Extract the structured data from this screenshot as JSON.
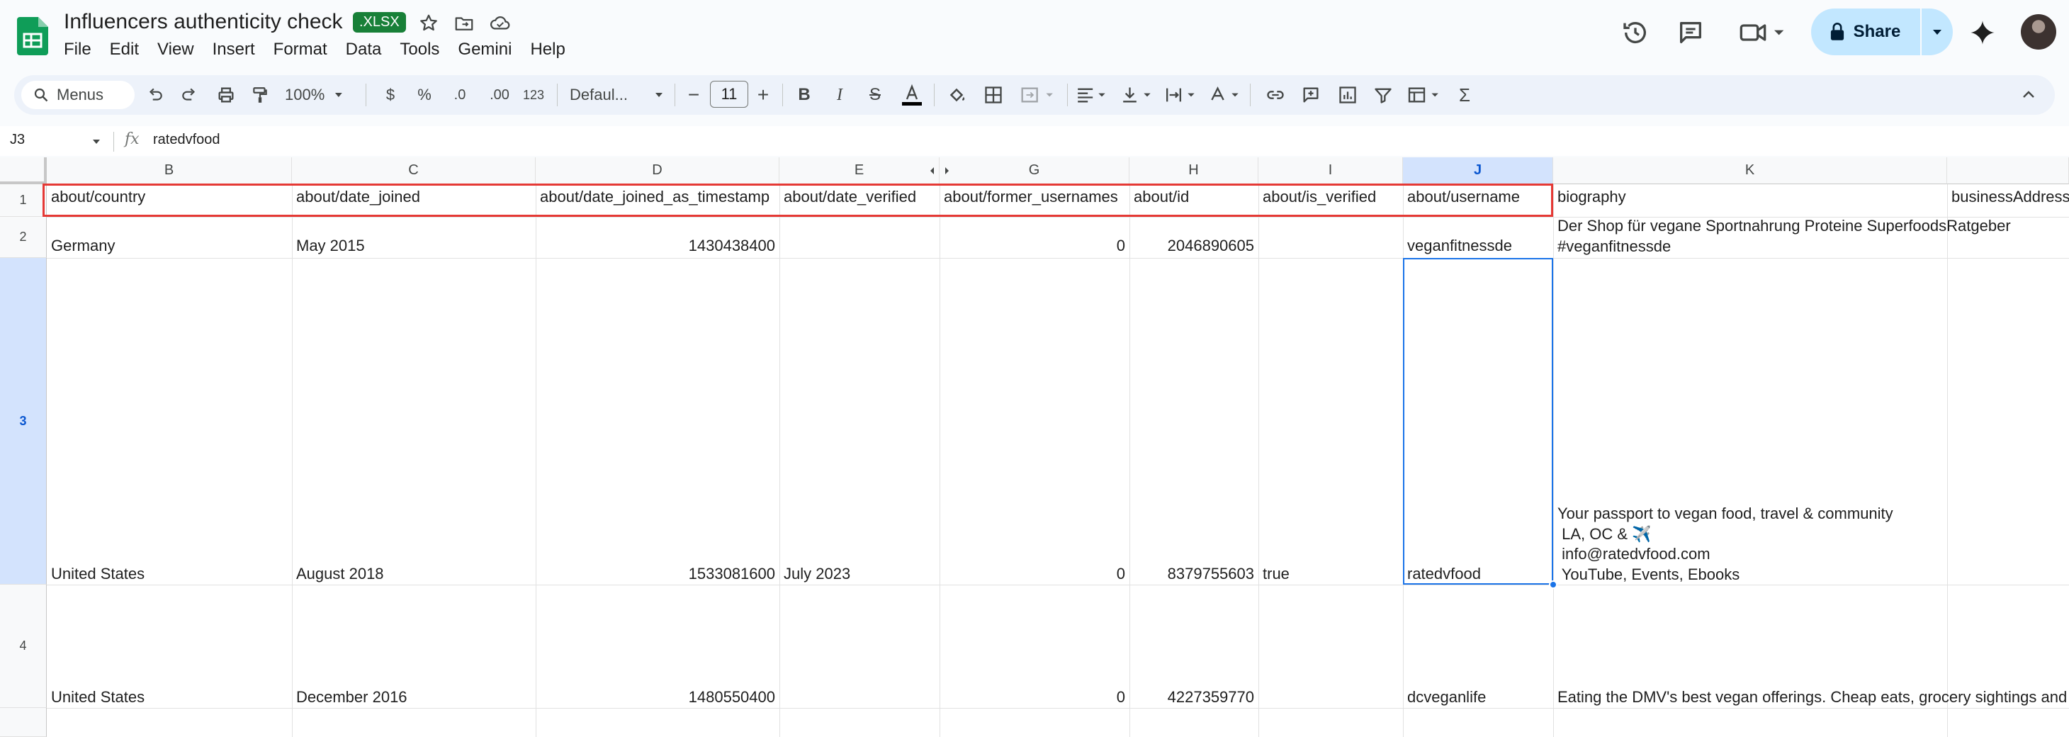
{
  "doc": {
    "title": "Influencers authenticity check",
    "format_badge": ".XLSX",
    "menu": [
      "File",
      "Edit",
      "View",
      "Insert",
      "Format",
      "Data",
      "Tools",
      "Gemini",
      "Help"
    ]
  },
  "header_actions": {
    "share_label": "Share"
  },
  "toolbar": {
    "menus_label": "Menus",
    "zoom": "100%",
    "currency": "$",
    "percent": "%",
    "decrease_decimal": ".0",
    "increase_decimal": ".00",
    "number_format": "123",
    "font": "Defaul...",
    "font_size": "11"
  },
  "formula_bar": {
    "cell_ref": "J3",
    "fx": "fx",
    "value": "ratedvfood"
  },
  "columns": [
    "B",
    "C",
    "D",
    "E",
    "G",
    "H",
    "I",
    "J",
    "K"
  ],
  "rows": [
    "1",
    "2",
    "3",
    "4"
  ],
  "row1": [
    "about/country",
    "about/date_joined",
    "about/date_joined_as_timestamp",
    "about/date_verified",
    "about/former_usernames",
    "about/id",
    "about/is_verified",
    "about/username",
    "biography",
    "businessAddress,"
  ],
  "row2": {
    "country": "Germany",
    "date_joined": "May 2015",
    "timestamp": "1430438400",
    "date_verified": "",
    "former_usernames": "0",
    "id": "2046890605",
    "is_verified": "",
    "username": "veganfitnessde",
    "biography": "Der Shop für vegane Sportnahrung Proteine SuperfoodsRatgeber\n#veganfitnessde"
  },
  "row3": {
    "country": "United States",
    "date_joined": "August 2018",
    "timestamp": "1533081600",
    "date_verified": "July 2023",
    "former_usernames": "0",
    "id": "8379755603",
    "is_verified": "true",
    "username": "ratedvfood",
    "biography": "Your passport to vegan food, travel & community\n LA, OC & ✈️\n info@ratedvfood.com\n YouTube, Events, Ebooks"
  },
  "row4": {
    "country": "United States",
    "date_joined": "December 2016",
    "timestamp": "1480550400",
    "date_verified": "",
    "former_usernames": "0",
    "id": "4227359770",
    "is_verified": "",
    "username": "dcveganlife",
    "biography": "Eating the DMV's best vegan offerings. Cheap eats, grocery sightings and mo"
  },
  "colors": {
    "accent": "#1a73e8",
    "highlight_border": "#e53935",
    "sheets_green": "#188038",
    "share_bg": "#c2e7ff"
  }
}
